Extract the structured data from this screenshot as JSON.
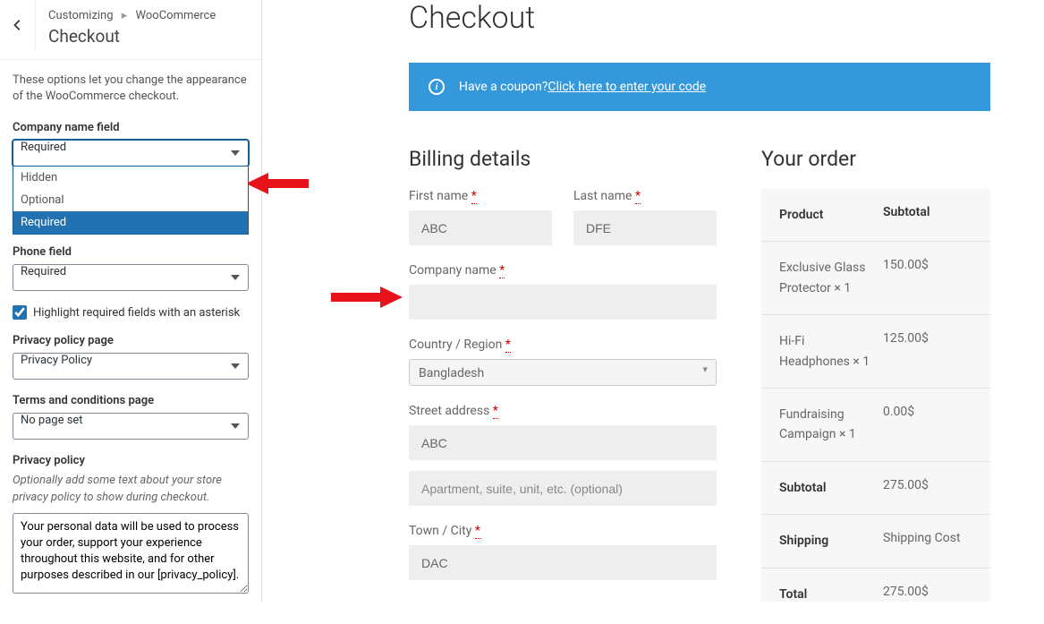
{
  "sidebar": {
    "breadcrumb_parent": "Customizing",
    "breadcrumb_current": "WooCommerce",
    "title": "Checkout",
    "description": "These options let you change the appearance of the WooCommerce checkout.",
    "company_field": {
      "label": "Company name field",
      "value": "Required",
      "options": [
        "Hidden",
        "Optional",
        "Required"
      ]
    },
    "phone_field": {
      "label": "Phone field",
      "value": "Required"
    },
    "highlight_checkbox_label": "Highlight required fields with an asterisk",
    "privacy_page": {
      "label": "Privacy policy page",
      "value": "Privacy Policy"
    },
    "terms_page": {
      "label": "Terms and conditions page",
      "value": "No page set"
    },
    "privacy_policy": {
      "label": "Privacy policy",
      "hint": "Optionally add some text about your store privacy policy to show during checkout.",
      "text": "Your personal data will be used to process your order, support your experience throughout this website, and for other purposes described in our [privacy_policy]."
    }
  },
  "main": {
    "title": "Checkout",
    "coupon": {
      "prompt": "Have a coupon? ",
      "link": "Click here to enter your code"
    },
    "billing": {
      "title": "Billing details",
      "first_name_label": "First name ",
      "first_name_value": "ABC",
      "last_name_label": "Last name ",
      "last_name_value": "DFE",
      "company_label": "Company name ",
      "company_value": "",
      "country_label": "Country / Region ",
      "country_value": "Bangladesh",
      "street_label": "Street address ",
      "street1_value": "ABC",
      "street2_placeholder": "Apartment, suite, unit, etc. (optional)",
      "town_label": "Town / City ",
      "town_value": "DAC"
    },
    "order": {
      "title": "Your order",
      "header_product": "Product",
      "header_subtotal": "Subtotal",
      "items": [
        {
          "name": "Exclusive Glass Protector ",
          "qty": "× 1",
          "subtotal": "150.00$"
        },
        {
          "name": "Hi-Fi Headphones ",
          "qty": "× 1",
          "subtotal": "125.00$"
        },
        {
          "name": "Fundraising Campaign ",
          "qty": "× 1",
          "subtotal": "0.00$"
        }
      ],
      "subtotal_label": "Subtotal",
      "subtotal_value": "275.00$",
      "shipping_label": "Shipping",
      "shipping_value": "Shipping Cost",
      "total_label": "Total",
      "total_value": "275.00$"
    }
  },
  "required_mark": "*"
}
